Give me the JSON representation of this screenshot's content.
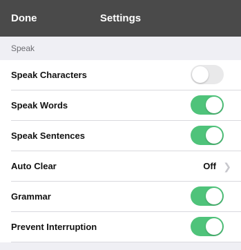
{
  "navbar": {
    "done_label": "Done",
    "title": "Settings"
  },
  "sections": {
    "speak": {
      "header": "Speak"
    }
  },
  "rows": [
    {
      "label": "Speak Characters",
      "type": "toggle",
      "on": false
    },
    {
      "label": "Speak Words",
      "type": "toggle",
      "on": true
    },
    {
      "label": "Speak Sentences",
      "type": "toggle",
      "on": true
    },
    {
      "label": "Auto Clear",
      "type": "disclosure",
      "value": "Off"
    },
    {
      "label": "Grammar",
      "type": "toggle",
      "on": true
    },
    {
      "label": "Prevent Interruption",
      "type": "toggle",
      "on": true
    }
  ],
  "colors": {
    "accent_on": "#4fc37a",
    "navbar_bg": "#4a4a4a"
  },
  "icons": {
    "chevron": "chevron-right-icon"
  }
}
